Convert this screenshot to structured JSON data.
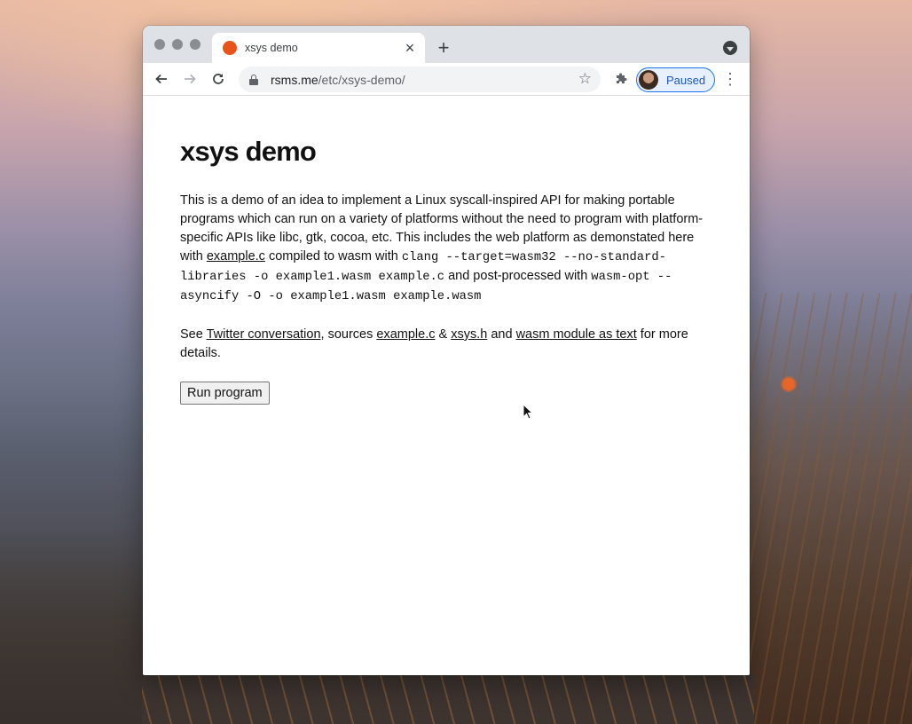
{
  "browser": {
    "tab_title": "xsys demo",
    "tab_close": "×",
    "new_tab": "+",
    "url_host": "rsms.me",
    "url_path": "/etc/xsys-demo/",
    "profile_label": "Paused",
    "icons": [
      "back-arrow-icon",
      "forward-arrow-icon",
      "reload-icon",
      "lock-icon",
      "star-icon",
      "puzzle-extension-icon",
      "kebab-menu-icon"
    ]
  },
  "page": {
    "title": "xsys demo",
    "para1": {
      "t1": "This is a demo of an idea to implement a Linux syscall-inspired API for making portable programs which can run on a variety of platforms without the need to program with platform-specific APIs like libc, gtk, cocoa, etc. This includes the web platform as demonstated here with ",
      "link1": "example.c",
      "t2": " compiled to wasm with ",
      "code1": "clang --target=wasm32 --no-standard-libraries -o example1.wasm example.c",
      "t3": " and post-processed with ",
      "code2": "wasm-opt --asyncify -O -o example1.wasm example.wasm"
    },
    "para2": {
      "t1": "See ",
      "link1": "Twitter conversation",
      "t2": ", sources ",
      "link2": "example.c",
      "t3": " & ",
      "link3": "xsys.h",
      "t4": " and ",
      "link4": "wasm module as text",
      "t5": " for more details."
    },
    "run_button": "Run program"
  },
  "colors": {
    "favicon": "#e8521b",
    "profile_border": "#1a73e8"
  }
}
